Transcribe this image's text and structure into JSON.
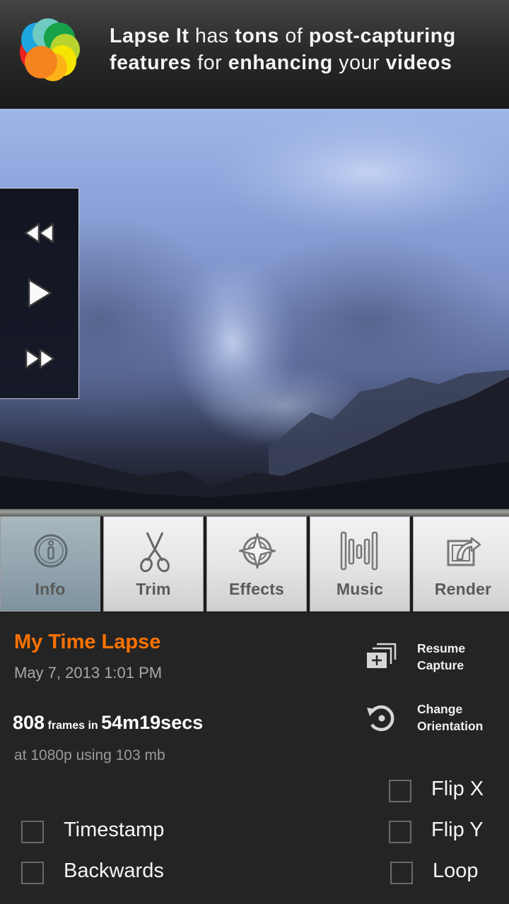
{
  "promo": {
    "segments": [
      {
        "text": "Lapse It",
        "bold": true
      },
      {
        "text": " has ",
        "bold": false
      },
      {
        "text": "tons",
        "bold": true
      },
      {
        "text": " of ",
        "bold": false
      },
      {
        "text": "post-capturing",
        "bold": true
      },
      {
        "text": " ",
        "bold": false
      },
      {
        "text": "features",
        "bold": true
      },
      {
        "text": " for ",
        "bold": false
      },
      {
        "text": "enhancing",
        "bold": true
      },
      {
        "text": " your ",
        "bold": false
      },
      {
        "text": "videos",
        "bold": true
      }
    ],
    "logo_icon": "lapse-it-logo-icon"
  },
  "playback": {
    "rewind_icon": "rewind-icon",
    "play_icon": "play-icon",
    "fast_forward_icon": "fast-forward-icon"
  },
  "toolbar": {
    "tabs": [
      {
        "label": "Info",
        "icon": "info-icon",
        "active": true
      },
      {
        "label": "Trim",
        "icon": "scissors-icon",
        "active": false
      },
      {
        "label": "Effects",
        "icon": "compass-star-icon",
        "active": false
      },
      {
        "label": "Music",
        "icon": "equalizer-bars-icon",
        "active": false
      },
      {
        "label": "Render",
        "icon": "share-export-icon",
        "active": false
      }
    ]
  },
  "info": {
    "title": "My Time Lapse",
    "date": "May 7, 2013 1:01 PM",
    "frames": "808",
    "frames_label": "frames in",
    "duration": "54m19secs",
    "resolution_text": "at 1080p using 103 mb"
  },
  "actions": {
    "resume_capture": {
      "label_line1": "Resume",
      "label_line2": "Capture",
      "icon": "stack-add-icon"
    },
    "change_orientation": {
      "label_line1": "Change",
      "label_line2": "Orientation",
      "icon": "rotate-icon"
    }
  },
  "options": {
    "timestamp": {
      "label": "Timestamp",
      "checked": false
    },
    "backwards": {
      "label": "Backwards",
      "checked": false
    },
    "flip_x": {
      "label": "Flip X",
      "checked": false
    },
    "flip_y": {
      "label": "Flip Y",
      "checked": false
    },
    "loop": {
      "label": "Loop",
      "checked": false
    }
  },
  "colors": {
    "accent_orange": "#ff7200",
    "active_tab": "#94a6b0",
    "panel_bg": "#242424"
  }
}
